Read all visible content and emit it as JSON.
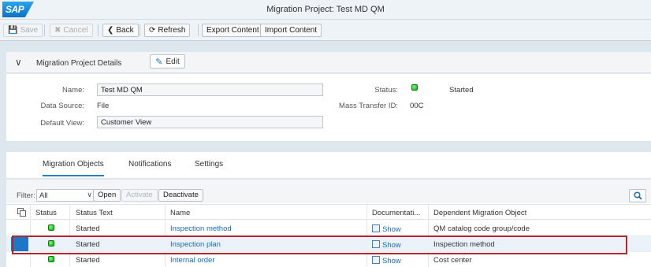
{
  "app": {
    "logo_text": "SAP",
    "title": "Migration Project: Test MD QM"
  },
  "toolbar": {
    "save": "Save",
    "cancel": "Cancel",
    "back": "Back",
    "refresh": "Refresh",
    "export": "Export Content",
    "import": "Import Content"
  },
  "details": {
    "panel_title": "Migration Project Details",
    "edit": "Edit",
    "name_label": "Name:",
    "name_value": "Test MD QM",
    "datasource_label": "Data Source:",
    "datasource_value": "File",
    "defaultview_label": "Default View:",
    "defaultview_value": "Customer View",
    "status_label": "Status:",
    "status_value": "Started",
    "masstransfer_label": "Mass Transfer ID:",
    "masstransfer_value": "00C",
    "status_color": "#13a913"
  },
  "tabs": [
    "Migration Objects",
    "Notifications",
    "Settings"
  ],
  "filter": {
    "label": "Filter:",
    "value": "All",
    "open": "Open",
    "activate": "Activate",
    "deactivate": "Deactivate"
  },
  "table": {
    "columns": [
      "Status",
      "Status Text",
      "Name",
      "Documentati...",
      "Dependent Migration Object"
    ],
    "rows": [
      {
        "status_text": "Started",
        "name": "Inspection method",
        "doc": "Show",
        "dependent": "QM catalog code group/code"
      },
      {
        "status_text": "Started",
        "name": "Inspection plan",
        "doc": "Show",
        "dependent": "Inspection method"
      },
      {
        "status_text": "Started",
        "name": "Internal order",
        "doc": "Show",
        "dependent": "Cost center"
      }
    ]
  },
  "colors": {
    "accent": "#1b6bb5",
    "highlight": "#b4262b",
    "selected_row_marker": "#1e77c6"
  }
}
